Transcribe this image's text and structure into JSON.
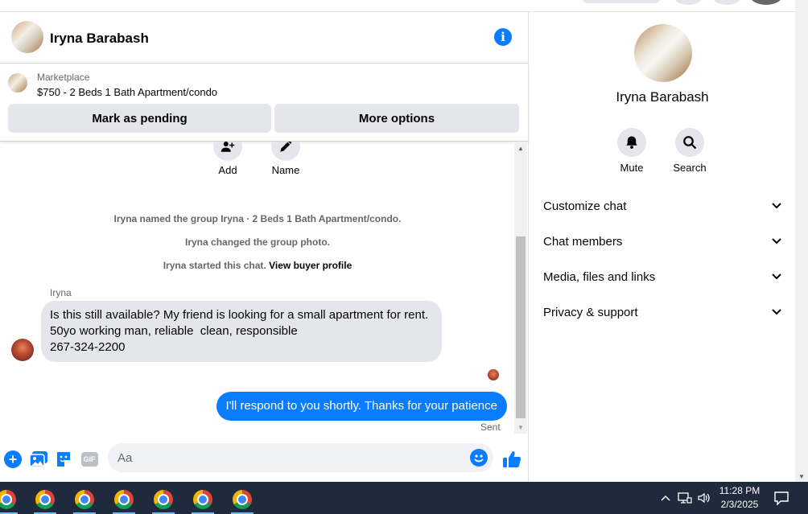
{
  "header": {
    "contact_name": "Iryna Barabash"
  },
  "listing": {
    "source": "Marketplace",
    "title": "$750 - 2 Beds 1 Bath Apartment/condo",
    "mark_pending_label": "Mark as pending",
    "more_options_label": "More options"
  },
  "group_actions": [
    {
      "label": "Add",
      "icon": "add-person-icon"
    },
    {
      "label": "Name",
      "icon": "pencil-icon"
    }
  ],
  "system_messages": {
    "named_group": "Iryna named the group Iryna · 2 Beds 1 Bath Apartment/condo.",
    "changed_photo": "Iryna changed the group photo.",
    "started_chat": "Iryna started this chat.",
    "view_buyer_profile": "View buyer profile"
  },
  "messages": {
    "incoming_sender": "Iryna",
    "incoming_lines": [
      "Is this still available? My friend is looking for a small apartment for rent.",
      "50yo working man, reliable  clean, responsible",
      "267-324-2200"
    ],
    "outgoing_text": "I'll respond to you shortly. Thanks for your patience",
    "status": "Sent"
  },
  "composer": {
    "placeholder": "Aa",
    "gif_label": "GIF"
  },
  "info_panel": {
    "name": "Iryna Barabash",
    "actions": [
      {
        "label": "Mute",
        "icon": "bell-icon"
      },
      {
        "label": "Search",
        "icon": "search-icon"
      }
    ],
    "sections": [
      "Customize chat",
      "Chat members",
      "Media, files and links",
      "Privacy & support"
    ]
  },
  "taskbar": {
    "time": "11:28 PM",
    "date": "2/3/2025"
  },
  "colors": {
    "accent": "#0a7cff",
    "bubble_in": "#e4e6eb",
    "taskbar": "#1f2a3c"
  }
}
